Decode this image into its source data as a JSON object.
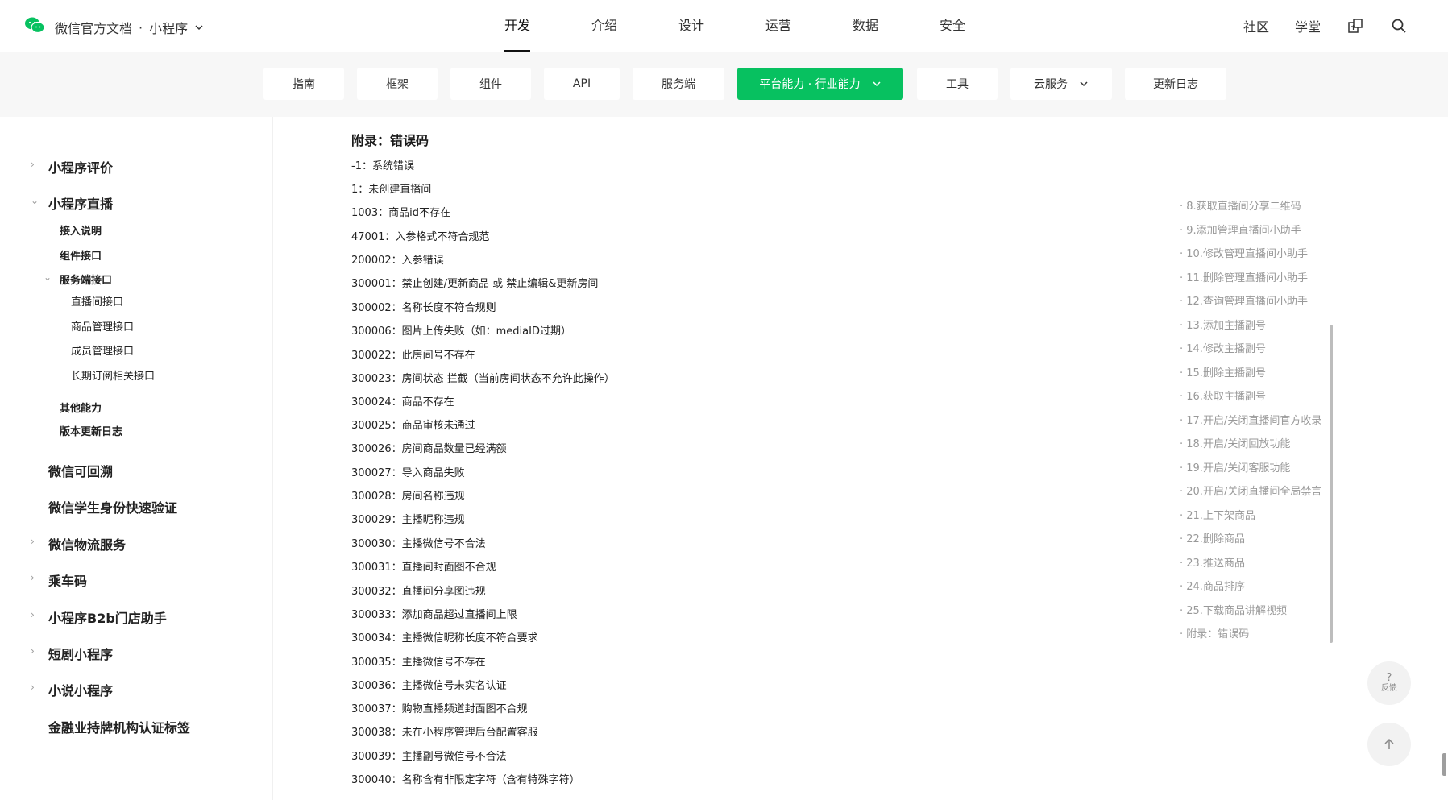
{
  "header": {
    "brand": "微信官方文档",
    "separator": "·",
    "product": "小程序",
    "tabs": [
      "开发",
      "介绍",
      "设计",
      "运营",
      "数据",
      "安全"
    ],
    "active_tab": "开发",
    "links": [
      "社区",
      "学堂"
    ],
    "icons": [
      "wechat-logo-icon",
      "translate-icon",
      "search-icon"
    ]
  },
  "subnav": {
    "items": [
      "指南",
      "框架",
      "组件",
      "API",
      "服务端",
      "平台能力 · 行业能力",
      "工具",
      "云服务",
      "更新日志"
    ],
    "active": "平台能力 · 行业能力",
    "accent_color": "#07c160"
  },
  "sidebar": {
    "items": [
      {
        "label": "小程序评价",
        "arrow": "›"
      },
      {
        "label": "小程序直播",
        "arrow": "⌄"
      },
      {
        "label": "接入说明"
      },
      {
        "label": "组件接口"
      },
      {
        "label": "服务端接口",
        "arrow": "⌄"
      },
      {
        "label": "直播间接口"
      },
      {
        "label": "商品管理接口"
      },
      {
        "label": "成员管理接口"
      },
      {
        "label": "长期订阅相关接口"
      },
      {
        "label": "其他能力"
      },
      {
        "label": "版本更新日志"
      },
      {
        "label": "微信可回溯"
      },
      {
        "label": "微信学生身份快速验证"
      },
      {
        "label": "微信物流服务",
        "arrow": "›"
      },
      {
        "label": "乘车码",
        "arrow": "›"
      },
      {
        "label": "小程序B2b门店助手",
        "arrow": "›"
      },
      {
        "label": "短剧小程序",
        "arrow": "›"
      },
      {
        "label": "小说小程序",
        "arrow": "›"
      },
      {
        "label": "金融业持牌机构认证标签"
      }
    ]
  },
  "content": {
    "title": "附录：错误码",
    "errors": [
      "-1：系统错误",
      "1：未创建直播间",
      "1003：商品id不存在",
      "47001：入参格式不符合规范",
      "200002：入参错误",
      "300001：禁止创建/更新商品 或 禁止编辑&更新房间",
      "300002：名称长度不符合规则",
      "300006：图片上传失败（如：mediaID过期）",
      "300022：此房间号不存在",
      "300023：房间状态 拦截（当前房间状态不允许此操作）",
      "300024：商品不存在",
      "300025：商品审核未通过",
      "300026：房间商品数量已经满额",
      "300027：导入商品失败",
      "300028：房间名称违规",
      "300029：主播昵称违规",
      "300030：主播微信号不合法",
      "300031：直播间封面图不合规",
      "300032：直播间分享图违规",
      "300033：添加商品超过直播间上限",
      "300034：主播微信昵称长度不符合要求",
      "300035：主播微信号不存在",
      "300036：主播微信号未实名认证",
      "300037：购物直播频道封面图不合规",
      "300038：未在小程序管理后台配置客服",
      "300039：主播副号微信号不合法",
      "300040：名称含有非限定字符（含有特殊字符）"
    ]
  },
  "toc": {
    "items": [
      "· 8.获取直播间分享二维码",
      "· 9.添加管理直播间小助手",
      "· 10.修改管理直播间小助手",
      "· 11.删除管理直播间小助手",
      "· 12.查询管理直播间小助手",
      "· 13.添加主播副号",
      "· 14.修改主播副号",
      "· 15.删除主播副号",
      "· 16.获取主播副号",
      "· 17.开启/关闭直播间官方收录",
      "· 18.开启/关闭回放功能",
      "· 19.开启/关闭客服功能",
      "· 20.开启/关闭直播间全局禁言",
      "· 21.上下架商品",
      "· 22.删除商品",
      "· 23.推送商品",
      "· 24.商品排序",
      "· 25.下载商品讲解视频",
      "· 附录：错误码"
    ]
  },
  "float": {
    "feedback_symbol": "?",
    "feedback_label": "反馈",
    "top_icon": "arrow-up-icon"
  }
}
